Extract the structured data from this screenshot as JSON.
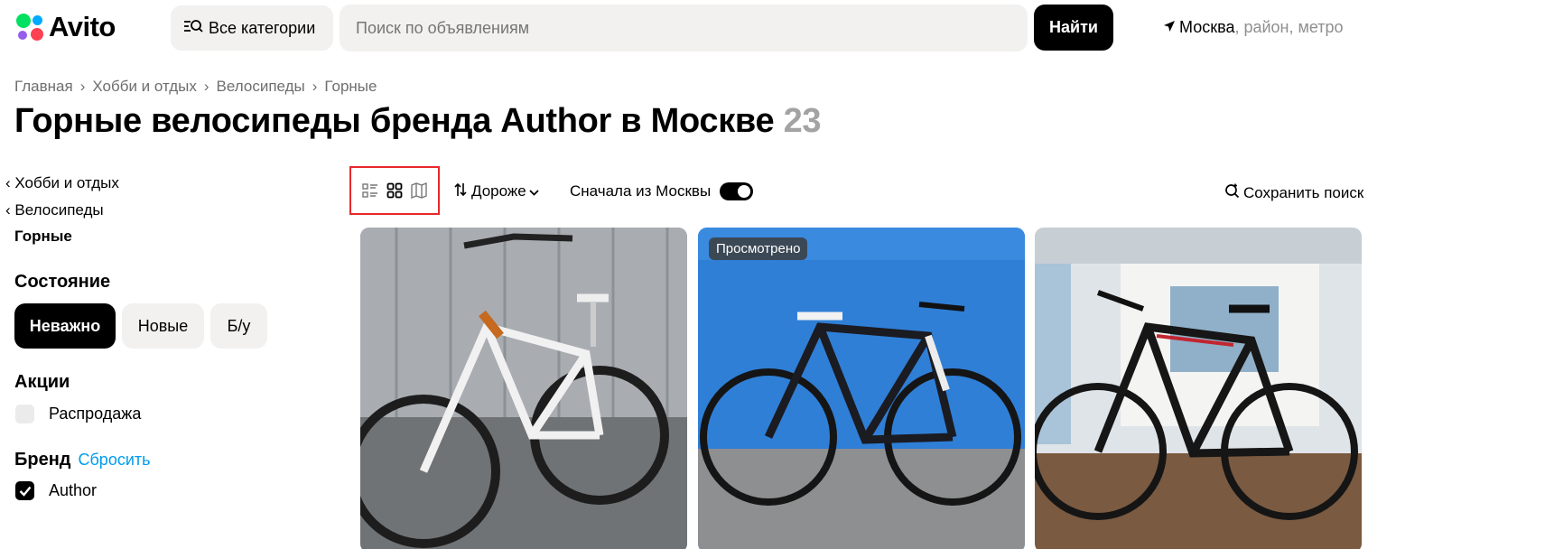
{
  "header": {
    "logo_text": "Avito",
    "categories_label": "Все категории",
    "search_placeholder": "Поиск по объявлениям",
    "find_label": "Найти",
    "location_city": "Москва",
    "location_rest": ", район, метро"
  },
  "breadcrumbs": [
    "Главная",
    "Хобби и отдых",
    "Велосипеды",
    "Горные"
  ],
  "title": {
    "text": "Горные велосипеды бренда Author в Москве",
    "count": "23"
  },
  "sidebar": {
    "back_links": [
      "Хобби и отдых",
      "Велосипеды"
    ],
    "current_category": "Горные",
    "condition": {
      "heading": "Состояние",
      "options": [
        "Неважно",
        "Новые",
        "Б/у"
      ],
      "selected": "Неважно"
    },
    "promotions": {
      "heading": "Акции",
      "option": "Распродажа",
      "checked": false
    },
    "brand": {
      "heading": "Бренд",
      "reset_label": "Сбросить",
      "option": "Author",
      "checked": true
    }
  },
  "toolbar": {
    "views": [
      "list-view-icon",
      "grid-view-icon",
      "map-view-icon"
    ],
    "sort_label": "Дороже",
    "moscow_first_label": "Сначала из Москвы",
    "moscow_first_enabled": true,
    "save_search_label": "Сохранить поиск"
  },
  "cards": [
    {
      "badge": ""
    },
    {
      "badge": "Просмотрено"
    },
    {
      "badge": ""
    }
  ],
  "colors": {
    "accent_blue": "#009cf0",
    "highlight_red": "#e8282b",
    "surface_gray": "#f2f1f0"
  }
}
